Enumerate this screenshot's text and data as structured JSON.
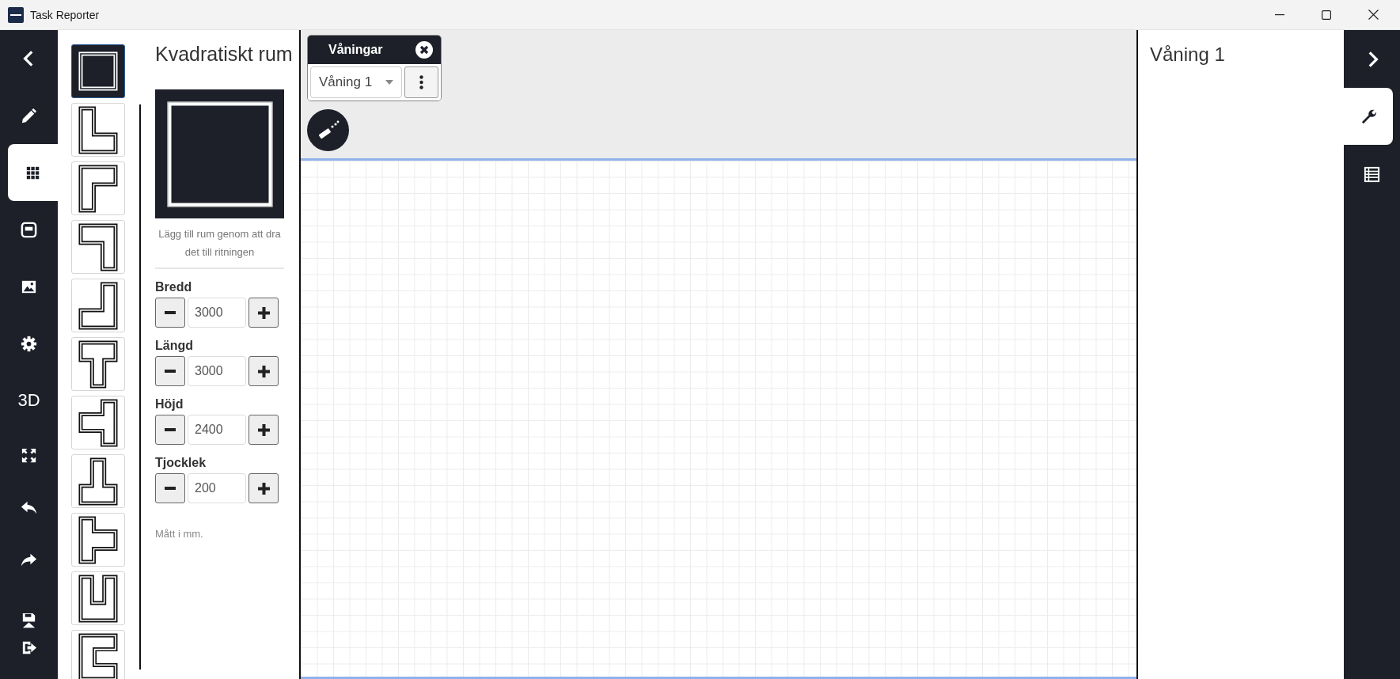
{
  "window": {
    "title": "Task Reporter"
  },
  "left_nav": {
    "items": [
      {
        "kind": "back",
        "selected": false
      },
      {
        "kind": "pencil",
        "selected": false
      },
      {
        "kind": "grid",
        "selected": true
      },
      {
        "kind": "panel",
        "selected": false
      },
      {
        "kind": "image",
        "selected": false
      },
      {
        "kind": "gear",
        "selected": false
      },
      {
        "kind": "label",
        "label": "3D",
        "selected": false
      },
      {
        "kind": "expand",
        "selected": false
      },
      {
        "kind": "undo",
        "selected": false
      },
      {
        "kind": "redo",
        "selected": false
      },
      {
        "kind": "save",
        "selected": false
      },
      {
        "kind": "exit",
        "selected": false
      }
    ]
  },
  "room_shapes": [
    {
      "kind": "square",
      "selected": true
    },
    {
      "kind": "l",
      "selected": false
    },
    {
      "kind": "gamma",
      "selected": false
    },
    {
      "kind": "seven",
      "selected": false
    },
    {
      "kind": "j",
      "selected": false
    },
    {
      "kind": "t",
      "selected": false
    },
    {
      "kind": "tleft",
      "selected": false
    },
    {
      "kind": "tup",
      "selected": false
    },
    {
      "kind": "tright",
      "selected": false
    },
    {
      "kind": "u",
      "selected": false
    },
    {
      "kind": "c",
      "selected": false
    }
  ],
  "room_panel": {
    "title": "Kvadratiskt rum",
    "caption": "Lägg till rum genom att dra det till ritningen",
    "fields": [
      {
        "label": "Bredd",
        "value": "3000"
      },
      {
        "label": "Längd",
        "value": "3000"
      },
      {
        "label": "Höjd",
        "value": "2400"
      },
      {
        "label": "Tjocklek",
        "value": "200"
      }
    ],
    "note": "Mått i mm."
  },
  "floors": {
    "title": "Våningar",
    "selected_floor": "Våning 1"
  },
  "properties": {
    "title": "Våning 1"
  },
  "right_nav": {
    "items": [
      {
        "kind": "forward",
        "selected": false
      },
      {
        "kind": "wrench",
        "selected": true
      },
      {
        "kind": "table",
        "selected": false
      }
    ]
  }
}
